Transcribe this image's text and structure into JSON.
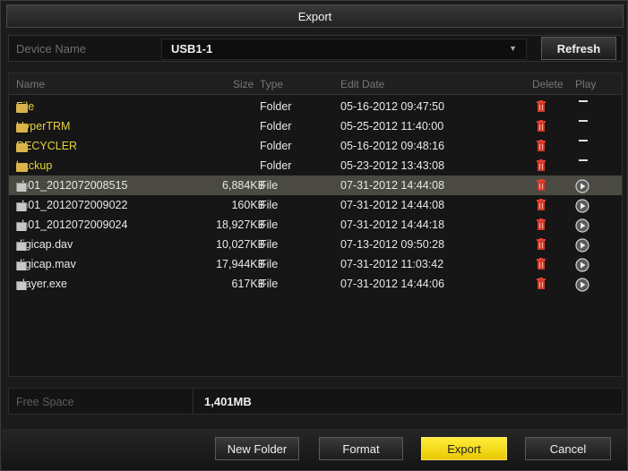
{
  "window": {
    "title": "Export"
  },
  "device": {
    "label": "Device Name",
    "value": "USB1-1",
    "refresh_label": "Refresh"
  },
  "table": {
    "columns": {
      "name": "Name",
      "size": "Size",
      "type": "Type",
      "edit_date": "Edit Date",
      "delete": "Delete",
      "play": "Play"
    },
    "rows": [
      {
        "name": "File",
        "size": "",
        "type": "Folder",
        "date": "05-16-2012 09:47:50",
        "kind": "folder"
      },
      {
        "name": "HyperTRM",
        "size": "",
        "type": "Folder",
        "date": "05-25-2012 11:40:00",
        "kind": "folder"
      },
      {
        "name": "RECYCLER",
        "size": "",
        "type": "Folder",
        "date": "05-16-2012 09:48:16",
        "kind": "folder"
      },
      {
        "name": "backup",
        "size": "",
        "type": "Folder",
        "date": "05-23-2012 13:43:08",
        "kind": "folder"
      },
      {
        "name": "ch01_2012072008515",
        "size": "6,884KB",
        "type": "File",
        "date": "07-31-2012 14:44:08",
        "kind": "file",
        "selected": true
      },
      {
        "name": "ch01_2012072009022",
        "size": "160KB",
        "type": "File",
        "date": "07-31-2012 14:44:08",
        "kind": "file"
      },
      {
        "name": "ch01_2012072009024",
        "size": "18,927KB",
        "type": "File",
        "date": "07-31-2012 14:44:18",
        "kind": "file"
      },
      {
        "name": "digicap.dav",
        "size": "10,027KB",
        "type": "File",
        "date": "07-13-2012 09:50:28",
        "kind": "file"
      },
      {
        "name": "digicap.mav",
        "size": "17,944KB",
        "type": "File",
        "date": "07-31-2012 11:03:42",
        "kind": "file"
      },
      {
        "name": "player.exe",
        "size": "617KB",
        "type": "File",
        "date": "07-31-2012 14:44:06",
        "kind": "file"
      }
    ]
  },
  "free_space": {
    "label": "Free Space",
    "value": "1,401MB"
  },
  "buttons": {
    "new_folder": "New Folder",
    "format": "Format",
    "export": "Export",
    "cancel": "Cancel"
  },
  "colors": {
    "accent": "#f2dc1e",
    "folder_text": "#e6d23a",
    "delete_icon": "#d03a2a",
    "selected_row": "#4a4a42"
  }
}
